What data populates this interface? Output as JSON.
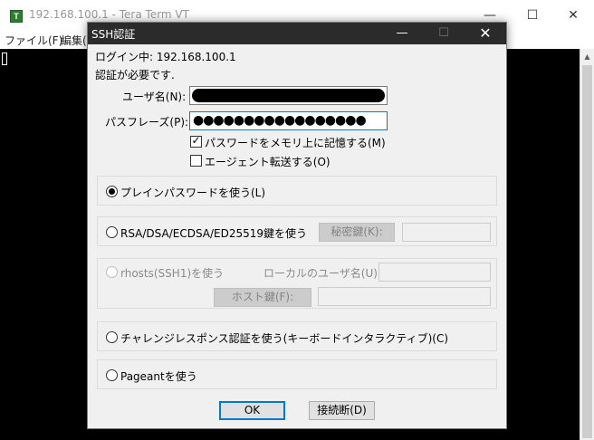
{
  "background_window": {
    "app_icon_glyph": "T",
    "title": "192.168.100.1 - Tera Term VT",
    "controls": {
      "minimize": "—",
      "maximize": "☐",
      "close": "✕"
    },
    "menu": [
      "ファイル(F)",
      "編集("
    ]
  },
  "dialog": {
    "title": "SSH認証",
    "controls": {
      "minimize": "—",
      "maximize": "☐",
      "close": "✕"
    },
    "login_status": "ログイン中: 192.168.100.1",
    "auth_required": "認証が必要です.",
    "username_label": "ユーザ名(N):",
    "passphrase_label": "パスフレーズ(P):",
    "passphrase_masked": "●●●●●●●●●●●●●●●●●",
    "remember_password": {
      "label": "パスワードをメモリ上に記憶する(M)",
      "checked": true,
      "mark": "✓"
    },
    "agent_forwarding": {
      "label": "エージェント転送する(O)",
      "checked": false
    },
    "methods": {
      "plain_password": {
        "label": "プレインパスワードを使う(L)",
        "selected": true
      },
      "rsa_key": {
        "label": "RSA/DSA/ECDSA/ED25519鍵を使う",
        "selected": false,
        "private_key_button": "秘密鍵(K):"
      },
      "rhosts": {
        "label": "rhosts(SSH1)を使う",
        "selected": false,
        "local_user_label": "ローカルのユーザ名(U):",
        "host_key_button": "ホスト鍵(F):"
      },
      "challenge": {
        "label": "チャレンジレスポンス認証を使う(キーボードインタラクティブ)(C)",
        "selected": false
      },
      "pageant": {
        "label": "Pageantを使う",
        "selected": false
      }
    },
    "buttons": {
      "ok": "OK",
      "disconnect": "接続断(D)"
    }
  },
  "colors": {
    "terminal_bg": "#000000",
    "dialog_titlebar": "#2b2b2b",
    "focus_accent": "#0078d7",
    "dialog_bg": "#f0f0f0"
  }
}
